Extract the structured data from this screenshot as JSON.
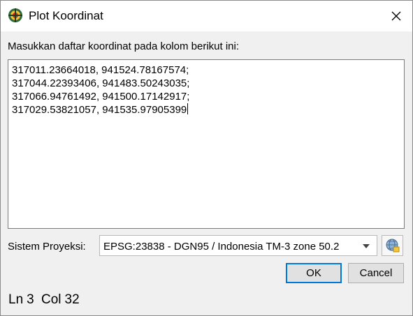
{
  "window": {
    "title": "Plot Koordinat",
    "app_icon": "qgis-globe-icon",
    "close_icon": "close-x-icon"
  },
  "instruction": "Masukkan daftar koordinat pada kolom berikut ini:",
  "coordinates": {
    "lines": [
      "317011.23664018, 941524.78167574;",
      "317044.22393406, 941483.50243035;",
      "317066.94761492, 941500.17142917;",
      "317029.53821057, 941535.97905399"
    ]
  },
  "projection": {
    "label": "Sistem Proyeksi:",
    "selected": "EPSG:23838 - DGN95 / Indonesia TM-3 zone 50.2",
    "dropdown_icon": "chevron-down-icon",
    "picker_icon": "globe-crs-icon"
  },
  "buttons": {
    "ok": "OK",
    "cancel": "Cancel"
  },
  "status": {
    "ln_label": "Ln",
    "ln_value": "3",
    "col_label": "Col",
    "col_value": "32"
  },
  "colors": {
    "focus_accent": "#0078d7",
    "window_bg": "#f0f0f0"
  }
}
